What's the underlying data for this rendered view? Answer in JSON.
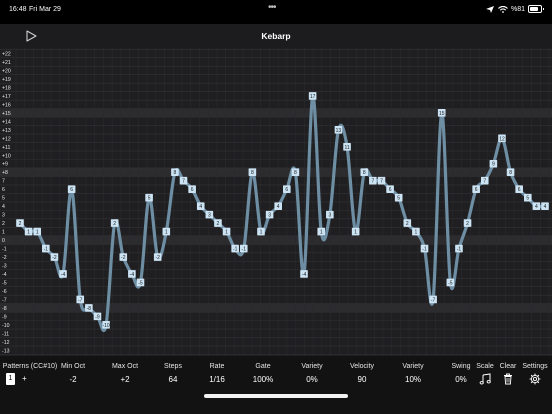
{
  "status": {
    "time": "16:48",
    "date": "Fri Mar 29",
    "battery": "%81",
    "battery_level": 0.81
  },
  "nav": {
    "title": "Kebarp",
    "play_icon": "play-icon"
  },
  "grid": {
    "y_labels": [
      "+22",
      "+21",
      "+20",
      "+19",
      "+18",
      "+17",
      "+16",
      "+15",
      "+14",
      "+13",
      "+12",
      "+11",
      "+10",
      "+9",
      "+8",
      "7",
      "6",
      "5",
      "4",
      "3",
      "2",
      "1",
      "0",
      "-1",
      "-2",
      "-3",
      "-4",
      "-5",
      "-6",
      "-7",
      "-8",
      "-9",
      "-10",
      "-11",
      "-12",
      "-13",
      "-14",
      "-15",
      "-16"
    ],
    "highlight_rows": [
      15,
      8,
      0,
      -8,
      -15
    ],
    "steps": [
      2,
      1,
      1,
      -1,
      -2,
      -4,
      6,
      -7,
      -8,
      -9,
      -10,
      2,
      -2,
      -4,
      -5,
      5,
      -2,
      1,
      8,
      7,
      6,
      4,
      3,
      2,
      1,
      -1,
      -1,
      8,
      1,
      3,
      4,
      6,
      8,
      -4,
      17,
      1,
      3,
      13,
      11,
      1,
      8,
      7,
      7,
      6,
      5,
      2,
      1,
      -1,
      -7,
      15,
      -5,
      -1,
      2,
      6,
      7,
      9,
      12,
      8,
      6,
      5,
      4,
      4
    ],
    "line_color": "#6e8ea4",
    "box_color": "#cbe3f3",
    "text_color": "#1a1a1a"
  },
  "controls": {
    "patterns_label": "Patterns (CC#10)",
    "pattern_value": "1",
    "pattern_add": "+",
    "min_oct_label": "Min Oct",
    "min_oct_value": "-2",
    "max_oct_label": "Max Oct",
    "max_oct_value": "+2",
    "steps_label": "Steps",
    "steps_value": "64",
    "rate_label": "Rate",
    "rate_value": "1/16",
    "gate_label": "Gate",
    "gate_value": "100%",
    "variety1_label": "Variety",
    "variety1_value": "0%",
    "velocity_label": "Velocity",
    "velocity_value": "90",
    "variety2_label": "Variety",
    "variety2_value": "10%",
    "swing_label": "Swing",
    "swing_value": "0%",
    "scale_label": "Scale",
    "scale_icon": "music-note-icon",
    "clear_label": "Clear",
    "clear_icon": "trash-icon",
    "settings_label": "Settings",
    "settings_icon": "gear-icon"
  }
}
